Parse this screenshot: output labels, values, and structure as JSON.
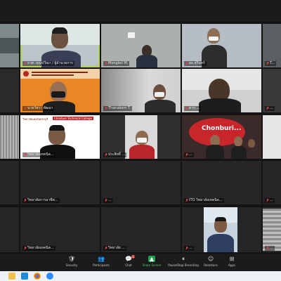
{
  "tiles": [
    {
      "name": "...",
      "bg": "#7e8a8c"
    },
    {
      "name": "อวศ. คุณปวีณา / ผู้อำนวยการ",
      "bg": "#b9c5c9"
    },
    {
      "name": "Mongkol M.",
      "bg": "#8a8f8b"
    },
    {
      "name": "",
      "bg": "#2b2b2b"
    },
    {
      "name": "ผอ.สุรินทร์",
      "bg": "#c7cbd0"
    },
    {
      "name": "T...",
      "bg": "#5b5f63"
    },
    {
      "name": "",
      "bg": "#2a2a2a"
    },
    {
      "name": "นายวัชรา พัฒนา",
      "bg": "#e98725"
    },
    {
      "name": "Thanakorn T.",
      "bg": "#bfbfbf"
    },
    {
      "name": "ตาก ...",
      "bg": "#cfd1cf"
    },
    {
      "name": "...",
      "bg": "#3a3a3a"
    },
    {
      "name": "...",
      "bg": "#9a9a9a"
    },
    {
      "name": "วิทยาลัยเทคนิค...",
      "bg": "#ffffff"
    },
    {
      "name": "ประสิทธิ์ ...",
      "bg": "#2f2f2f"
    },
    {
      "name": "Chonburi...",
      "bg": "#3a2a2a"
    },
    {
      "name": "...",
      "bg": "#3a3a3a"
    },
    {
      "name": "",
      "bg": "#2a2a2a"
    },
    {
      "name": "วิทยาลัยการอาชีพ...",
      "bg": "#262626"
    },
    {
      "name": "...",
      "bg": "#262626"
    },
    {
      "name": "ITO วิทยาลัยเทคนิค...",
      "bg": "#262626"
    },
    {
      "name": "...",
      "bg": "#262626"
    },
    {
      "name": "",
      "bg": "#262626"
    },
    {
      "name": "วิทยาลัยเทคนิค...",
      "bg": "#262626"
    },
    {
      "name": "วิทยาลัย ...",
      "bg": "#262626"
    },
    {
      "name": "...",
      "bg": "#c5d3df"
    },
    {
      "name": "...",
      "bg": "#2c2c2c"
    }
  ],
  "poster": {
    "line1": "วิทยาลัยเทคนิคชลบุรี",
    "line2": "Chonburi Technical College"
  },
  "controls": [
    {
      "label": "Security",
      "icon": "🛡"
    },
    {
      "label": "Participants",
      "icon": "👥"
    },
    {
      "label": "Chat",
      "icon": "💬"
    },
    {
      "label": "Share Screen",
      "icon": "▲"
    },
    {
      "label": "Pause/Stop Recording",
      "icon": "⏸"
    },
    {
      "label": "Reactions",
      "icon": "☺"
    },
    {
      "label": "Apps",
      "icon": "⊞"
    }
  ],
  "chat_badge": "1",
  "colors": {
    "active_border": "#b7d34a",
    "share_green": "#23a24d",
    "mic_red": "#e0413a"
  }
}
